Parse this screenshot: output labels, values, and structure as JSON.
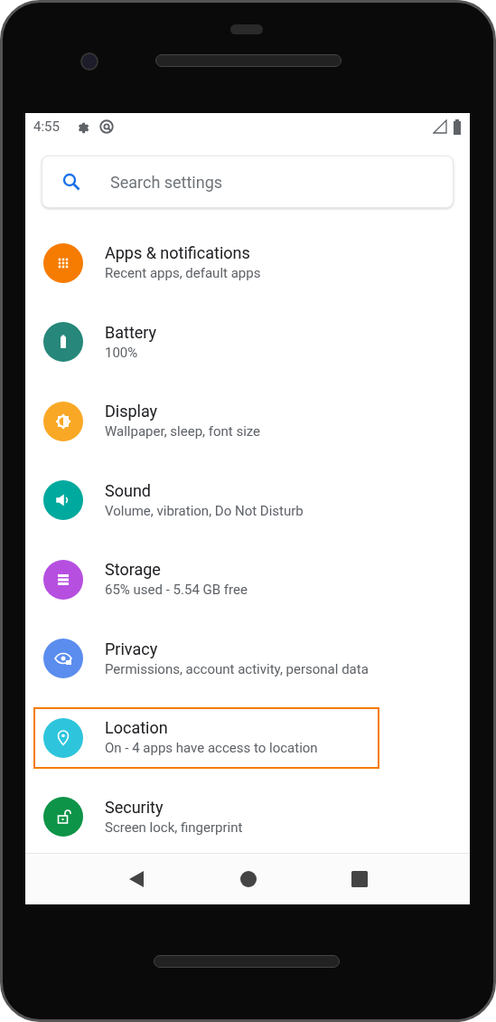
{
  "status_bar": {
    "time": "4:55"
  },
  "search": {
    "placeholder": "Search settings"
  },
  "items": [
    {
      "kind": "apps",
      "color": "#f57c00",
      "title": "Apps & notifications",
      "subtitle": "Recent apps, default apps",
      "highlighted": false
    },
    {
      "kind": "battery",
      "color": "#26877a",
      "title": "Battery",
      "subtitle": "100%",
      "highlighted": false
    },
    {
      "kind": "display",
      "color": "#f9a825",
      "title": "Display",
      "subtitle": "Wallpaper, sleep, font size",
      "highlighted": false
    },
    {
      "kind": "sound",
      "color": "#00a99d",
      "title": "Sound",
      "subtitle": "Volume, vibration, Do Not Disturb",
      "highlighted": false
    },
    {
      "kind": "storage",
      "color": "#b64fe0",
      "title": "Storage",
      "subtitle": "65% used - 5.54 GB free",
      "highlighted": false
    },
    {
      "kind": "privacy",
      "color": "#5b8def",
      "title": "Privacy",
      "subtitle": "Permissions, account activity, personal data",
      "highlighted": false
    },
    {
      "kind": "location",
      "color": "#2ec5dc",
      "title": "Location",
      "subtitle": "On - 4 apps have access to location",
      "highlighted": true
    },
    {
      "kind": "security",
      "color": "#0d9448",
      "title": "Security",
      "subtitle": "Screen lock, fingerprint",
      "highlighted": false
    }
  ]
}
